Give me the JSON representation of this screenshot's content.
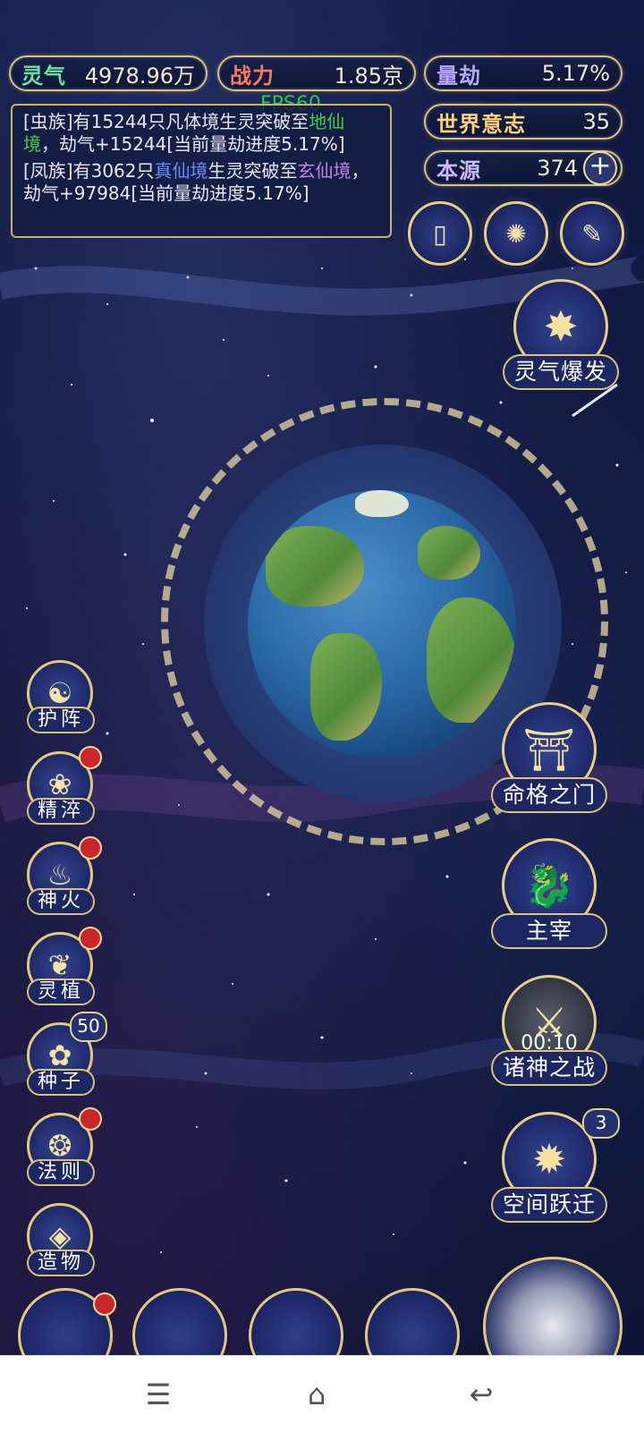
{
  "resources": {
    "lingqi": {
      "label": "灵气",
      "value": "4978.96万"
    },
    "zhanli": {
      "label": "战力",
      "value": "1.85京"
    },
    "liangjie": {
      "label": "量劫",
      "value": "5.17%"
    },
    "shijie": {
      "label": "世界意志",
      "value": "35"
    },
    "benyuan": {
      "label": "本源",
      "value": "374",
      "plus": "+"
    }
  },
  "fps": "FPS60",
  "log": {
    "entry1": {
      "p1": "[虫族]有15244只凡体境生灵突破至",
      "hl1": "地仙境",
      "p2": "，劫气+15244[当前量劫进度5.17%]"
    },
    "entry2": {
      "p1": "[凤族]有3062只",
      "hl1": "真仙境",
      "p2": "生灵突破至",
      "hl2": "玄仙境",
      "p3": "，劫气+97984[当前量劫进度5.17%]"
    }
  },
  "top_icons": {
    "book": "▯",
    "vortex": "✺",
    "scroll": "✎"
  },
  "burst_button": {
    "label": "灵气爆发"
  },
  "left_menu": [
    {
      "label": "护阵",
      "icon": "☯"
    },
    {
      "label": "精淬",
      "icon": "❀"
    },
    {
      "label": "神火",
      "icon": "♨"
    },
    {
      "label": "灵植",
      "icon": "❦"
    },
    {
      "label": "种子",
      "icon": "✿",
      "badge": "50"
    },
    {
      "label": "法则",
      "icon": "❂"
    },
    {
      "label": "造物",
      "icon": "◈"
    }
  ],
  "right_menu": [
    {
      "label": "命格之门",
      "icon": "⛩"
    },
    {
      "label": "主宰",
      "icon": "🐉"
    },
    {
      "label": "诸神之战",
      "icon": "⚔",
      "timer": "00:10"
    },
    {
      "label": "空间跃迁",
      "icon": "✹",
      "badge": "3"
    }
  ],
  "colors": {
    "gold": "#d9c27a",
    "highlight_green": "#3fd14a",
    "highlight_purple": "#c783e6",
    "highlight_blue": "#6d8cff"
  }
}
